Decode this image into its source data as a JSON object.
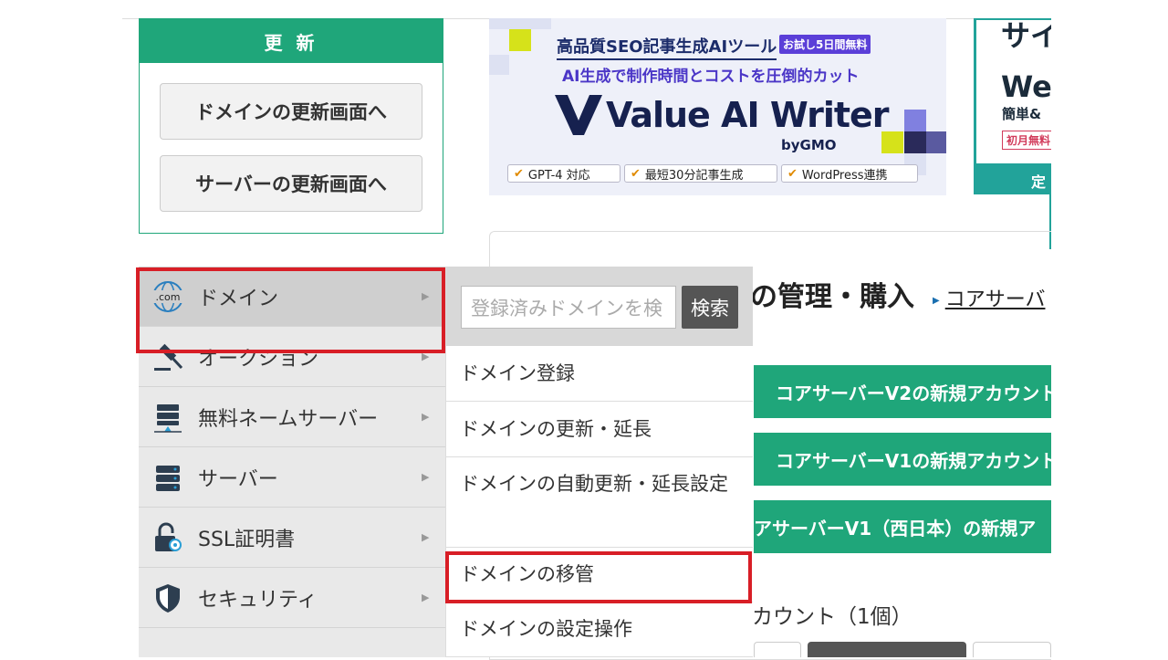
{
  "update": {
    "header": "更 新",
    "domain_button": "ドメインの更新画面へ",
    "server_button": "サーバーの更新画面へ"
  },
  "ad1": {
    "line1": "高品質SEO記事生成AIツール",
    "badge": "お試し5日間無料",
    "line2": "AI生成で制作時間とコストを圧倒的カット",
    "logo": "Value AI Writer",
    "by": "byGMO",
    "tags": [
      "GPT-4 対応",
      "最短30分記事生成",
      "WordPress連携"
    ]
  },
  "ad2": {
    "t1": "サイ",
    "t2": "We",
    "t3": "簡単&",
    "t4": "初月無料",
    "t5": "定"
  },
  "main": {
    "title": "の管理・購入",
    "link": "コアサーバ",
    "buttons": [
      "コアサーバーV2の新規アカウント",
      "コアサーバーV1の新規アカウント",
      "アサーバーV1（西日本）の新規ア"
    ],
    "account_count": "カウント（1個）"
  },
  "menu": {
    "items": [
      {
        "label": "ドメイン",
        "icon": "dotcom-globe-icon"
      },
      {
        "label": "オークション",
        "icon": "gavel-icon"
      },
      {
        "label": "無料ネームサーバー",
        "icon": "nameserver-icon"
      },
      {
        "label": "サーバー",
        "icon": "server-icon"
      },
      {
        "label": "SSL証明書",
        "icon": "ssl-lock-icon"
      },
      {
        "label": "セキュリティ",
        "icon": "shield-icon"
      }
    ]
  },
  "submenu": {
    "search_placeholder": "登録済みドメインを検",
    "search_button": "検索",
    "items": [
      "ドメイン登録",
      "ドメインの更新・延長",
      "ドメインの自動更新・延長設定",
      "ドメインの移管",
      "ドメインの設定操作"
    ]
  },
  "colors": {
    "brand_green": "#1fa67a",
    "highlight_red": "#d81e26",
    "ad_teal": "#22a39a"
  }
}
